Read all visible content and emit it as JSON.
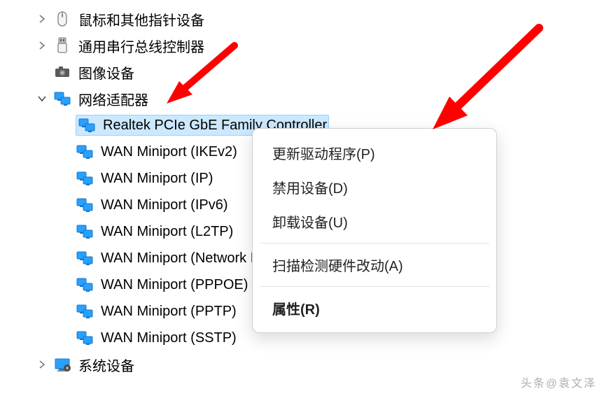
{
  "tree": {
    "mouse": {
      "label": "鼠标和其他指针设备"
    },
    "usb": {
      "label": "通用串行总线控制器"
    },
    "imaging": {
      "label": "图像设备"
    },
    "netadapt": {
      "label": "网络适配器"
    },
    "adapters": [
      {
        "label": "Realtek PCIe GbE Family Controller"
      },
      {
        "label": "WAN Miniport (IKEv2)"
      },
      {
        "label": "WAN Miniport (IP)"
      },
      {
        "label": "WAN Miniport (IPv6)"
      },
      {
        "label": "WAN Miniport (L2TP)"
      },
      {
        "label": "WAN Miniport (Network Monitor)"
      },
      {
        "label": "WAN Miniport (PPPOE)"
      },
      {
        "label": "WAN Miniport (PPTP)"
      },
      {
        "label": "WAN Miniport (SSTP)"
      }
    ],
    "sysdev": {
      "label": "系统设备"
    }
  },
  "context_menu": {
    "update": "更新驱动程序(P)",
    "disable": "禁用设备(D)",
    "uninstall": "卸载设备(U)",
    "scan": "扫描检测硬件改动(A)",
    "properties": "属性(R)"
  },
  "watermark": "头条@袁文泽"
}
